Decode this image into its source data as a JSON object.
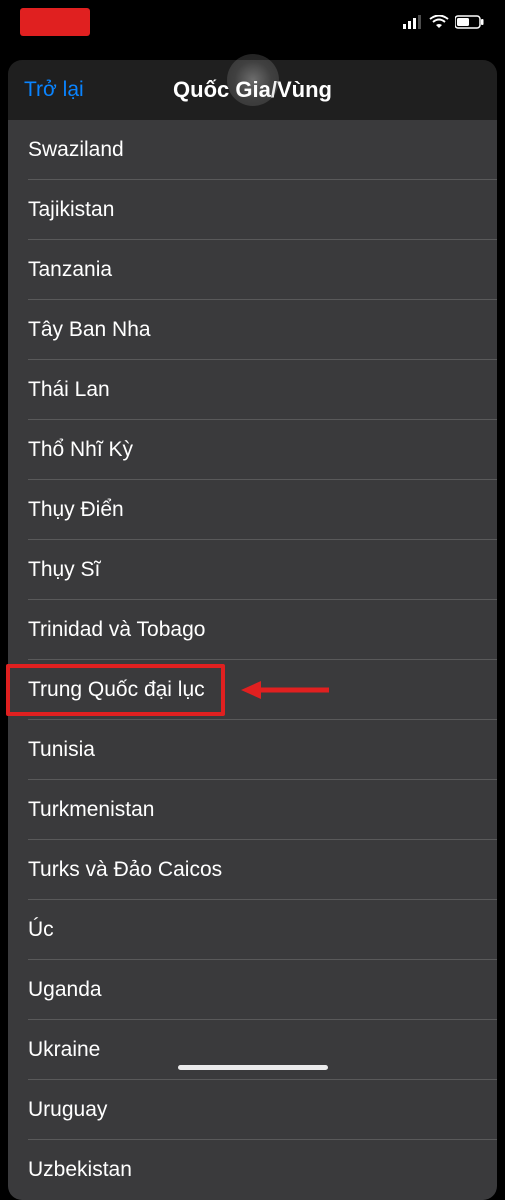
{
  "nav": {
    "back_label": "Trở lại",
    "title": "Quốc Gia/Vùng"
  },
  "countries": [
    "Swaziland",
    "Tajikistan",
    "Tanzania",
    "Tây Ban Nha",
    "Thái Lan",
    "Thổ Nhĩ Kỳ",
    "Thụy Điển",
    "Thụy Sĩ",
    "Trinidad và Tobago",
    "Trung Quốc đại lục",
    "Tunisia",
    "Turkmenistan",
    "Turks và Đảo Caicos",
    "Úc",
    "Uganda",
    "Ukraine",
    "Uruguay",
    "Uzbekistan"
  ],
  "annotation": {
    "highlighted_index": 9,
    "highlight_color": "#e02020"
  }
}
